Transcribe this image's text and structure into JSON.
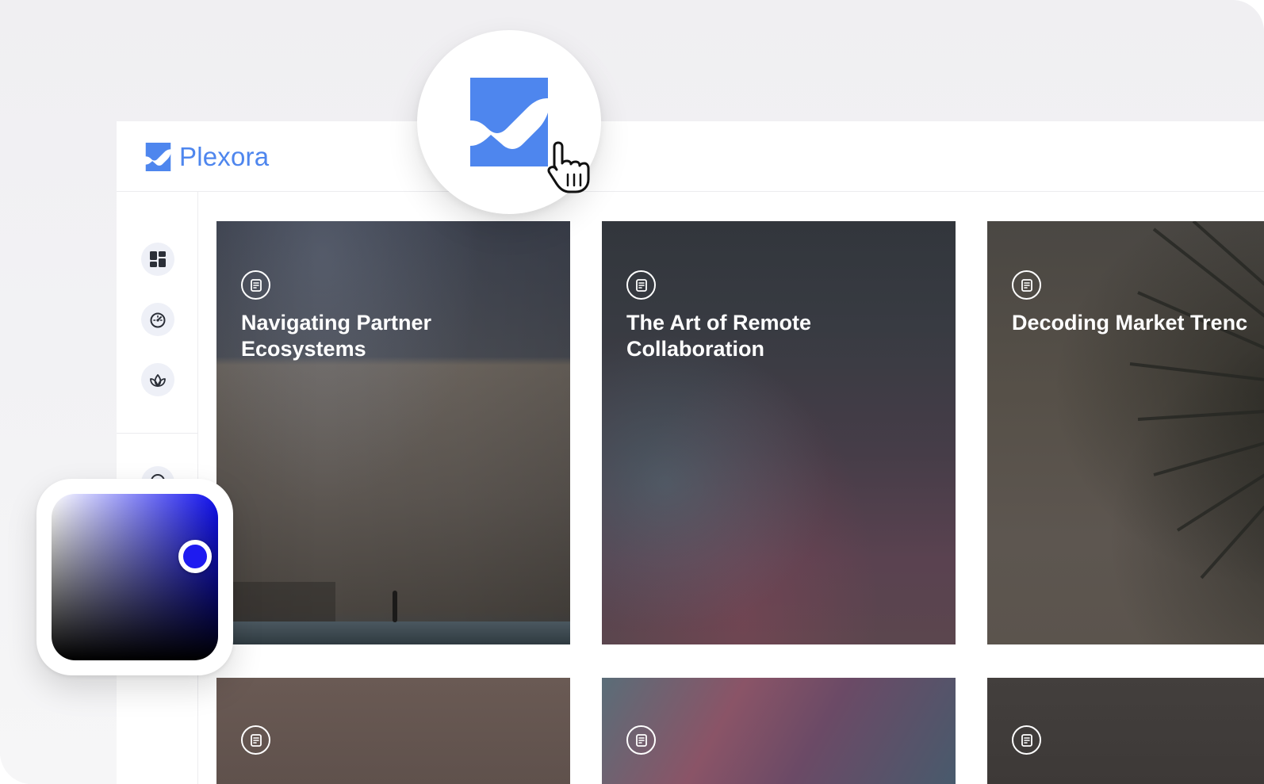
{
  "app": {
    "name": "Plexora",
    "brand_color": "#4e86ee"
  },
  "sidebar": {
    "items": [
      {
        "icon": "dashboard-icon"
      },
      {
        "icon": "speedometer-icon"
      },
      {
        "icon": "lotus-icon"
      },
      {
        "icon": "location-pin-icon"
      }
    ]
  },
  "cards": [
    {
      "title": "Navigating Partner\nEcosystems",
      "icon": "document-icon"
    },
    {
      "title": "The Art of Remote\nCollaboration",
      "icon": "document-icon"
    },
    {
      "title": "Decoding Market Trenc",
      "icon": "document-icon"
    },
    {
      "title": "",
      "icon": "document-icon"
    },
    {
      "title": "",
      "icon": "document-icon"
    },
    {
      "title": "",
      "icon": "document-icon"
    }
  ],
  "color_picker": {
    "selected_color": "#1e1bf0",
    "hue_color": "#1010ee"
  }
}
